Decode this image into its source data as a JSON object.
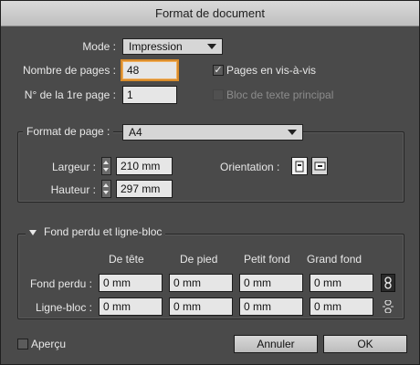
{
  "window": {
    "title": "Format de document"
  },
  "mode": {
    "label": "Mode :",
    "value": "Impression"
  },
  "pages": {
    "count_label": "Nombre de pages :",
    "count_value": "48",
    "facing_label": "Pages en vis-à-vis",
    "facing_checked": true,
    "first_label": "N° de la 1re page :",
    "first_value": "1",
    "primary_text_label": "Bloc de texte principal",
    "primary_text_checked": false
  },
  "page_size": {
    "label": "Format de page :",
    "value": "A4",
    "width_label": "Largeur :",
    "width_value": "210 mm",
    "height_label": "Hauteur :",
    "height_value": "297 mm",
    "orientation_label": "Orientation :"
  },
  "bleed": {
    "section_label": "Fond perdu et ligne-bloc",
    "columns": [
      "De tête",
      "De pied",
      "Petit fond",
      "Grand fond"
    ],
    "bleed_label": "Fond perdu :",
    "bleed_values": [
      "0 mm",
      "0 mm",
      "0 mm",
      "0 mm"
    ],
    "slug_label": "Ligne-bloc :",
    "slug_values": [
      "0 mm",
      "0 mm",
      "0 mm",
      "0 mm"
    ]
  },
  "footer": {
    "preview_label": "Aperçu",
    "preview_checked": false,
    "cancel_label": "Annuler",
    "ok_label": "OK"
  }
}
